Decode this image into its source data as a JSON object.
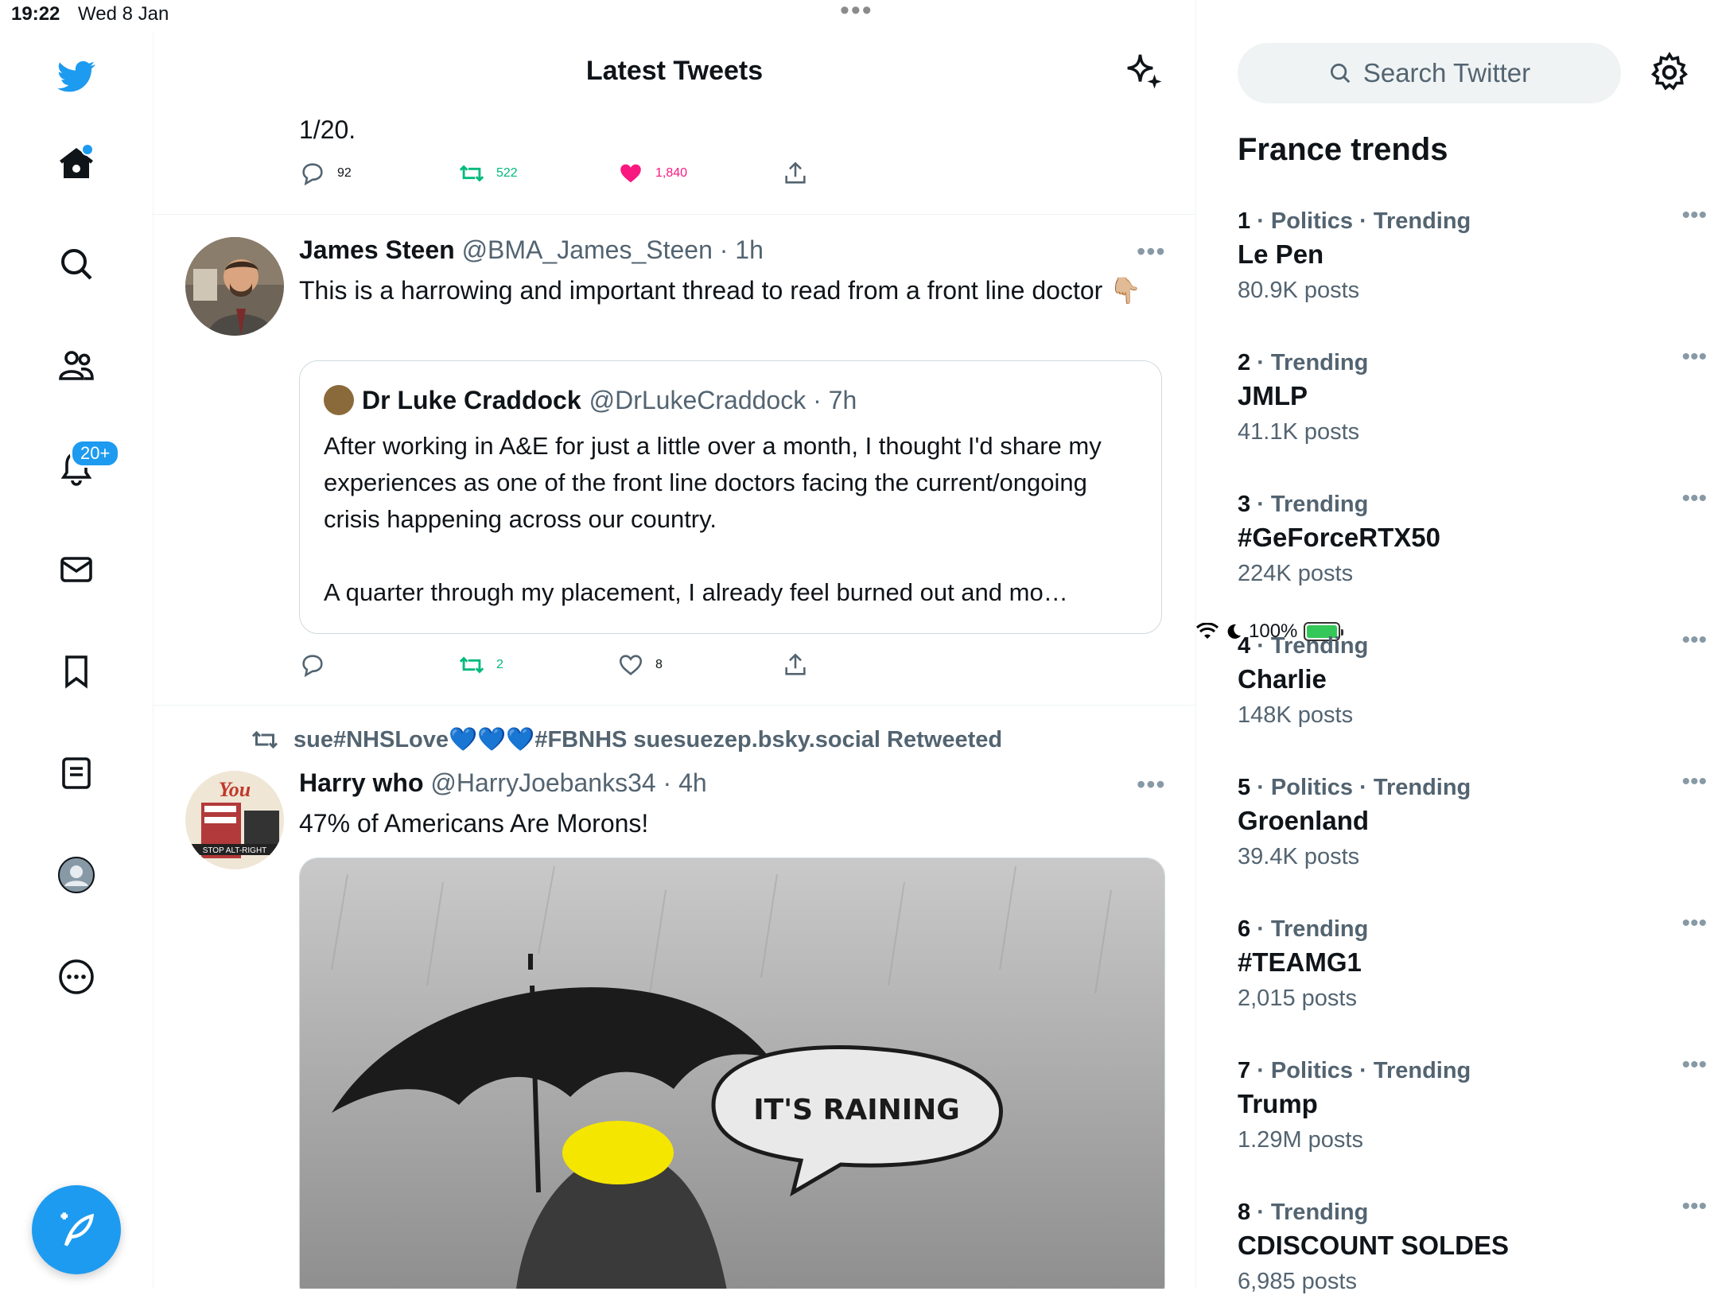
{
  "status_bar": {
    "time": "19:22",
    "date": "Wed 8 Jan",
    "battery": "100%"
  },
  "sidebar": {
    "notifications_badge": "20+"
  },
  "header": {
    "title": "Latest Tweets"
  },
  "tweets": [
    {
      "text": "1/20.",
      "replies": "92",
      "retweets": "522",
      "likes": "1,840"
    },
    {
      "name": "James Steen",
      "handle": "@BMA_James_Steen · 1h",
      "text": "This is a harrowing and important thread to read from a front line doctor 👇🏼",
      "quote": {
        "name": "Dr Luke Craddock",
        "handle": "@DrLukeCraddock · 7h",
        "text_1": "After working in A&E for just a little over a month, I thought I'd share my experiences as one of the front line doctors facing the current/ongoing crisis happening across our country.",
        "text_2": "A quarter through my placement, I already feel burned out and mo…"
      },
      "replies": "",
      "retweets": "2",
      "likes": "8"
    },
    {
      "retweeted_by": "sue#NHSLove💙💙💙#FBNHS suesuezep.bsky.social Retweeted",
      "name": "Harry who",
      "handle": "@HarryJoebanks34 · 4h",
      "text": "47% of Americans Are Morons!",
      "image_caption": "IT'S RAINING"
    }
  ],
  "right_panel": {
    "search_placeholder": "Search Twitter",
    "trends_title": "France trends",
    "trends": [
      {
        "rank": "1",
        "context": " · Politics · Trending",
        "term": "Le Pen",
        "count": "80.9K posts"
      },
      {
        "rank": "2",
        "context": " · Trending",
        "term": "JMLP",
        "count": "41.1K posts"
      },
      {
        "rank": "3",
        "context": " · Trending",
        "term": "#GeForceRTX50",
        "count": "224K posts"
      },
      {
        "rank": "4",
        "context": " · Trending",
        "term": "Charlie",
        "count": "148K posts"
      },
      {
        "rank": "5",
        "context": " · Politics · Trending",
        "term": "Groenland",
        "count": "39.4K posts"
      },
      {
        "rank": "6",
        "context": " · Trending",
        "term": "#TEAMG1",
        "count": "2,015 posts"
      },
      {
        "rank": "7",
        "context": " · Politics · Trending",
        "term": "Trump",
        "count": "1.29M posts"
      },
      {
        "rank": "8",
        "context": " · Trending",
        "term": "CDISCOUNT SOLDES",
        "count": "6,985 posts"
      }
    ]
  },
  "colors": {
    "brand": "#1d9bf0",
    "retweet": "#00ba7c",
    "like": "#f91880",
    "secondary_text": "#536471"
  }
}
